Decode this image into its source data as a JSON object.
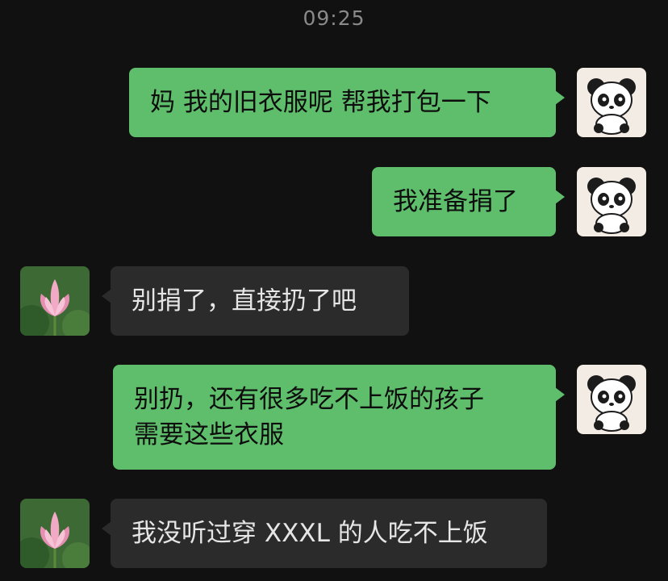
{
  "timestamp": "09:25",
  "messages": [
    {
      "side": "out",
      "avatar": "panda-avatar",
      "lines": [
        "妈 我的旧衣服呢 帮我打包一下"
      ]
    },
    {
      "side": "out",
      "avatar": "panda-avatar",
      "lines": [
        "我准备捐了"
      ]
    },
    {
      "side": "in",
      "avatar": "lotus-avatar",
      "lines": [
        "别捐了，直接扔了吧"
      ]
    },
    {
      "side": "out",
      "avatar": "panda-avatar",
      "lines": [
        "别扔，还有很多吃不上饭的孩子",
        "需要这些衣服"
      ]
    },
    {
      "side": "in",
      "avatar": "lotus-avatar",
      "lines": [
        "我没听过穿 XXXL 的人吃不上饭"
      ]
    }
  ],
  "colors": {
    "background": "#111111",
    "outgoing_bubble": "#5fbe6b",
    "incoming_bubble": "#2b2b2b",
    "timestamp_text": "#8a8a8a"
  }
}
